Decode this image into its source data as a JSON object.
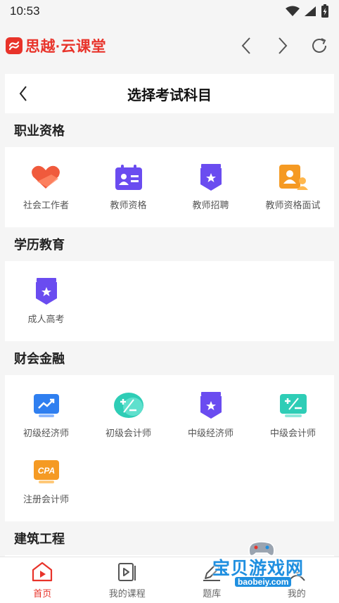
{
  "status_bar": {
    "time": "10:53"
  },
  "header": {
    "brand_name": "思越·云课堂"
  },
  "page": {
    "title": "选择考试科目"
  },
  "sections": [
    {
      "title": "职业资格",
      "items": [
        {
          "label": "社会工作者",
          "icon": "hands-heart-icon",
          "color": "#f05a3c"
        },
        {
          "label": "教师资格",
          "icon": "id-card-icon",
          "color": "#6a4cf0"
        },
        {
          "label": "教师招聘",
          "icon": "badge-star-icon",
          "color": "#6a4cf0"
        },
        {
          "label": "教师资格面试",
          "icon": "user-card-icon",
          "color": "#f59a23"
        }
      ]
    },
    {
      "title": "学历教育",
      "items": [
        {
          "label": "成人高考",
          "icon": "badge-star-icon",
          "color": "#6a4cf0"
        }
      ]
    },
    {
      "title": "财会金融",
      "items": [
        {
          "label": "初级经济师",
          "icon": "trend-chart-icon",
          "color": "#2f7ff0"
        },
        {
          "label": "初级会计师",
          "icon": "plus-minus-icon",
          "color": "#2ecdb6"
        },
        {
          "label": "中级经济师",
          "icon": "badge-star-icon",
          "color": "#6a4cf0"
        },
        {
          "label": "中级会计师",
          "icon": "plus-minus-card-icon",
          "color": "#2ecdb6"
        },
        {
          "label": "注册会计师",
          "icon": "cpa-icon",
          "color": "#f59a23"
        }
      ]
    },
    {
      "title": "建筑工程",
      "items": []
    }
  ],
  "tabs": [
    {
      "label": "首页",
      "icon": "home-play-icon",
      "active": true
    },
    {
      "label": "我的课程",
      "icon": "video-course-icon",
      "active": false
    },
    {
      "label": "题库",
      "icon": "pencil-icon",
      "active": false
    },
    {
      "label": "我的",
      "icon": "user-icon",
      "active": false
    }
  ],
  "watermark": {
    "text": "宝贝游戏网",
    "url": "baobeiy.com"
  },
  "colors": {
    "accent": "#e8332a",
    "background": "#f5f5f5"
  }
}
